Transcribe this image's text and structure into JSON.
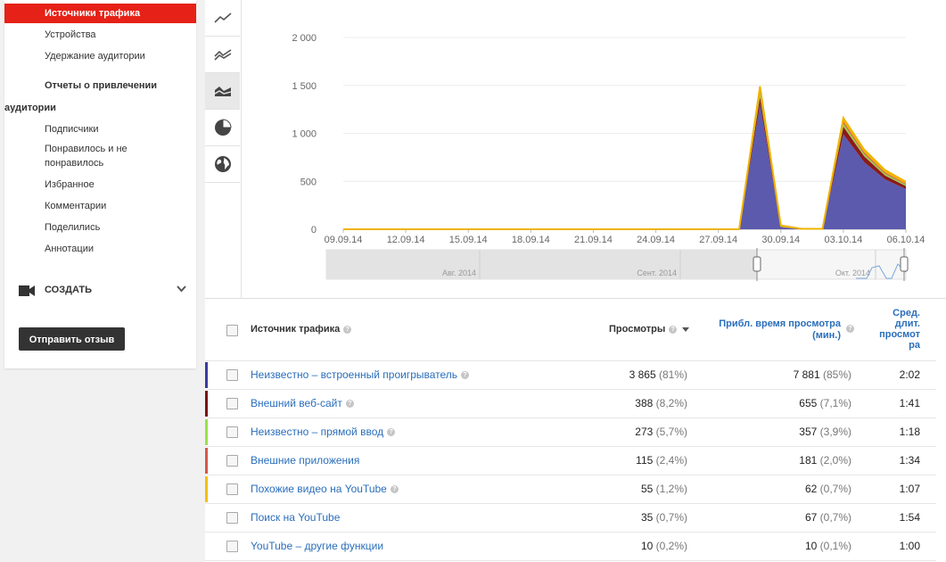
{
  "sidebar": {
    "active_item": "Источники трафика",
    "items": [
      "Устройства",
      "Удержание аудитории"
    ],
    "section_line1": "Отчеты о привлечении",
    "section_line2": "аудитории",
    "items2": [
      "Подписчики",
      "Понравилось и не",
      "понравилось",
      "Избранное",
      "Комментарии",
      "Поделились",
      "Аннотации"
    ],
    "create_label": "СОЗДАТЬ",
    "feedback_button": "Отправить отзыв"
  },
  "toolbar": {
    "icons": [
      "line-chart-icon",
      "multiline-chart-icon",
      "stacked-area-icon",
      "pie-chart-icon",
      "globe-icon"
    ],
    "active_index": 2
  },
  "chart_data": {
    "type": "area",
    "y_ticks": [
      "2 000",
      "1 500",
      "1 000",
      "500",
      "0"
    ],
    "x_tick_labels": [
      "09.09.14",
      "12.09.14",
      "15.09.14",
      "18.09.14",
      "21.09.14",
      "24.09.14",
      "27.09.14",
      "30.09.14",
      "03.10.14",
      "06.10.14"
    ],
    "x": [
      "09.09.14",
      "10.09.14",
      "11.09.14",
      "12.09.14",
      "13.09.14",
      "14.09.14",
      "15.09.14",
      "16.09.14",
      "17.09.14",
      "18.09.14",
      "19.09.14",
      "20.09.14",
      "21.09.14",
      "22.09.14",
      "23.09.14",
      "24.09.14",
      "25.09.14",
      "26.09.14",
      "27.09.14",
      "28.09.14",
      "29.09.14",
      "30.09.14",
      "01.10.14",
      "02.10.14",
      "03.10.14",
      "04.10.14",
      "05.10.14",
      "06.10.14"
    ],
    "ylim": [
      0,
      2000
    ],
    "stacked": true,
    "grid": true,
    "series": [
      {
        "name": "Неизвестно – встроенный проигрыватель",
        "color": "#5c5aad",
        "values": [
          0,
          0,
          0,
          0,
          0,
          0,
          0,
          0,
          0,
          0,
          0,
          0,
          0,
          0,
          0,
          0,
          0,
          0,
          0,
          0,
          1300,
          20,
          0,
          0,
          990,
          700,
          520,
          420
        ]
      },
      {
        "name": "Внешний веб-сайт",
        "color": "#8b1a1a",
        "values": [
          0,
          0,
          0,
          0,
          0,
          0,
          0,
          0,
          0,
          0,
          0,
          0,
          0,
          0,
          0,
          0,
          0,
          0,
          0,
          0,
          80,
          5,
          0,
          0,
          80,
          60,
          40,
          30
        ]
      },
      {
        "name": "Неизвестно – прямой ввод",
        "color": "#99cc44",
        "values": [
          0,
          0,
          0,
          0,
          0,
          0,
          0,
          0,
          0,
          0,
          0,
          0,
          0,
          0,
          0,
          0,
          0,
          0,
          0,
          0,
          40,
          5,
          0,
          0,
          35,
          25,
          20,
          15
        ]
      },
      {
        "name": "Внешние приложения",
        "color": "#d9534f",
        "values": [
          0,
          0,
          0,
          0,
          0,
          0,
          0,
          0,
          0,
          0,
          0,
          0,
          0,
          0,
          0,
          0,
          0,
          0,
          0,
          0,
          30,
          3,
          0,
          0,
          20,
          15,
          12,
          10
        ]
      },
      {
        "name": "Похожие видео на YouTube",
        "color": "#f0b400",
        "values": [
          0,
          0,
          0,
          0,
          0,
          0,
          0,
          0,
          0,
          0,
          0,
          0,
          0,
          0,
          0,
          0,
          0,
          0,
          0,
          0,
          40,
          7,
          5,
          5,
          35,
          30,
          25,
          20
        ]
      }
    ],
    "range_labels": [
      "Авг. 2014",
      "Сент. 2014",
      "Окт. 2014"
    ]
  },
  "table": {
    "headers": {
      "source": "Источник трафика",
      "views": "Просмотры",
      "watch_line1": "Прибл. время просмотра",
      "watch_line2": "(мин.)",
      "avg_line1": "Сред.",
      "avg_line2": "длит.",
      "avg_line3": "просмот",
      "avg_line4": "ра"
    },
    "rows": [
      {
        "source": "Неизвестно – встроенный проигрыватель",
        "views": "3 865",
        "views_pct": "(81%)",
        "watch": "7 881",
        "watch_pct": "(85%)",
        "avg": "2:02",
        "color": "#3b3b9e",
        "help": true
      },
      {
        "source": "Внешний веб-сайт",
        "views": "388",
        "views_pct": "(8,2%)",
        "watch": "655",
        "watch_pct": "(7,1%)",
        "avg": "1:41",
        "color": "#7a1212",
        "help": true
      },
      {
        "source": "Неизвестно – прямой ввод",
        "views": "273",
        "views_pct": "(5,7%)",
        "watch": "357",
        "watch_pct": "(3,9%)",
        "avg": "1:18",
        "color": "#99e04a",
        "help": true
      },
      {
        "source": "Внешние приложения",
        "views": "115",
        "views_pct": "(2,4%)",
        "watch": "181",
        "watch_pct": "(2,0%)",
        "avg": "1:34",
        "color": "#d35a4a",
        "help": false
      },
      {
        "source": "Похожие видео на YouTube",
        "views": "55",
        "views_pct": "(1,2%)",
        "watch": "62",
        "watch_pct": "(0,7%)",
        "avg": "1:07",
        "color": "#f5c000",
        "help": true
      },
      {
        "source": "Поиск на YouTube",
        "views": "35",
        "views_pct": "(0,7%)",
        "watch": "67",
        "watch_pct": "(0,7%)",
        "avg": "1:54",
        "color": "",
        "help": false
      },
      {
        "source": "YouTube – другие функции",
        "views": "10",
        "views_pct": "(0,2%)",
        "watch": "10",
        "watch_pct": "(0,1%)",
        "avg": "1:00",
        "color": "",
        "help": false
      }
    ]
  }
}
